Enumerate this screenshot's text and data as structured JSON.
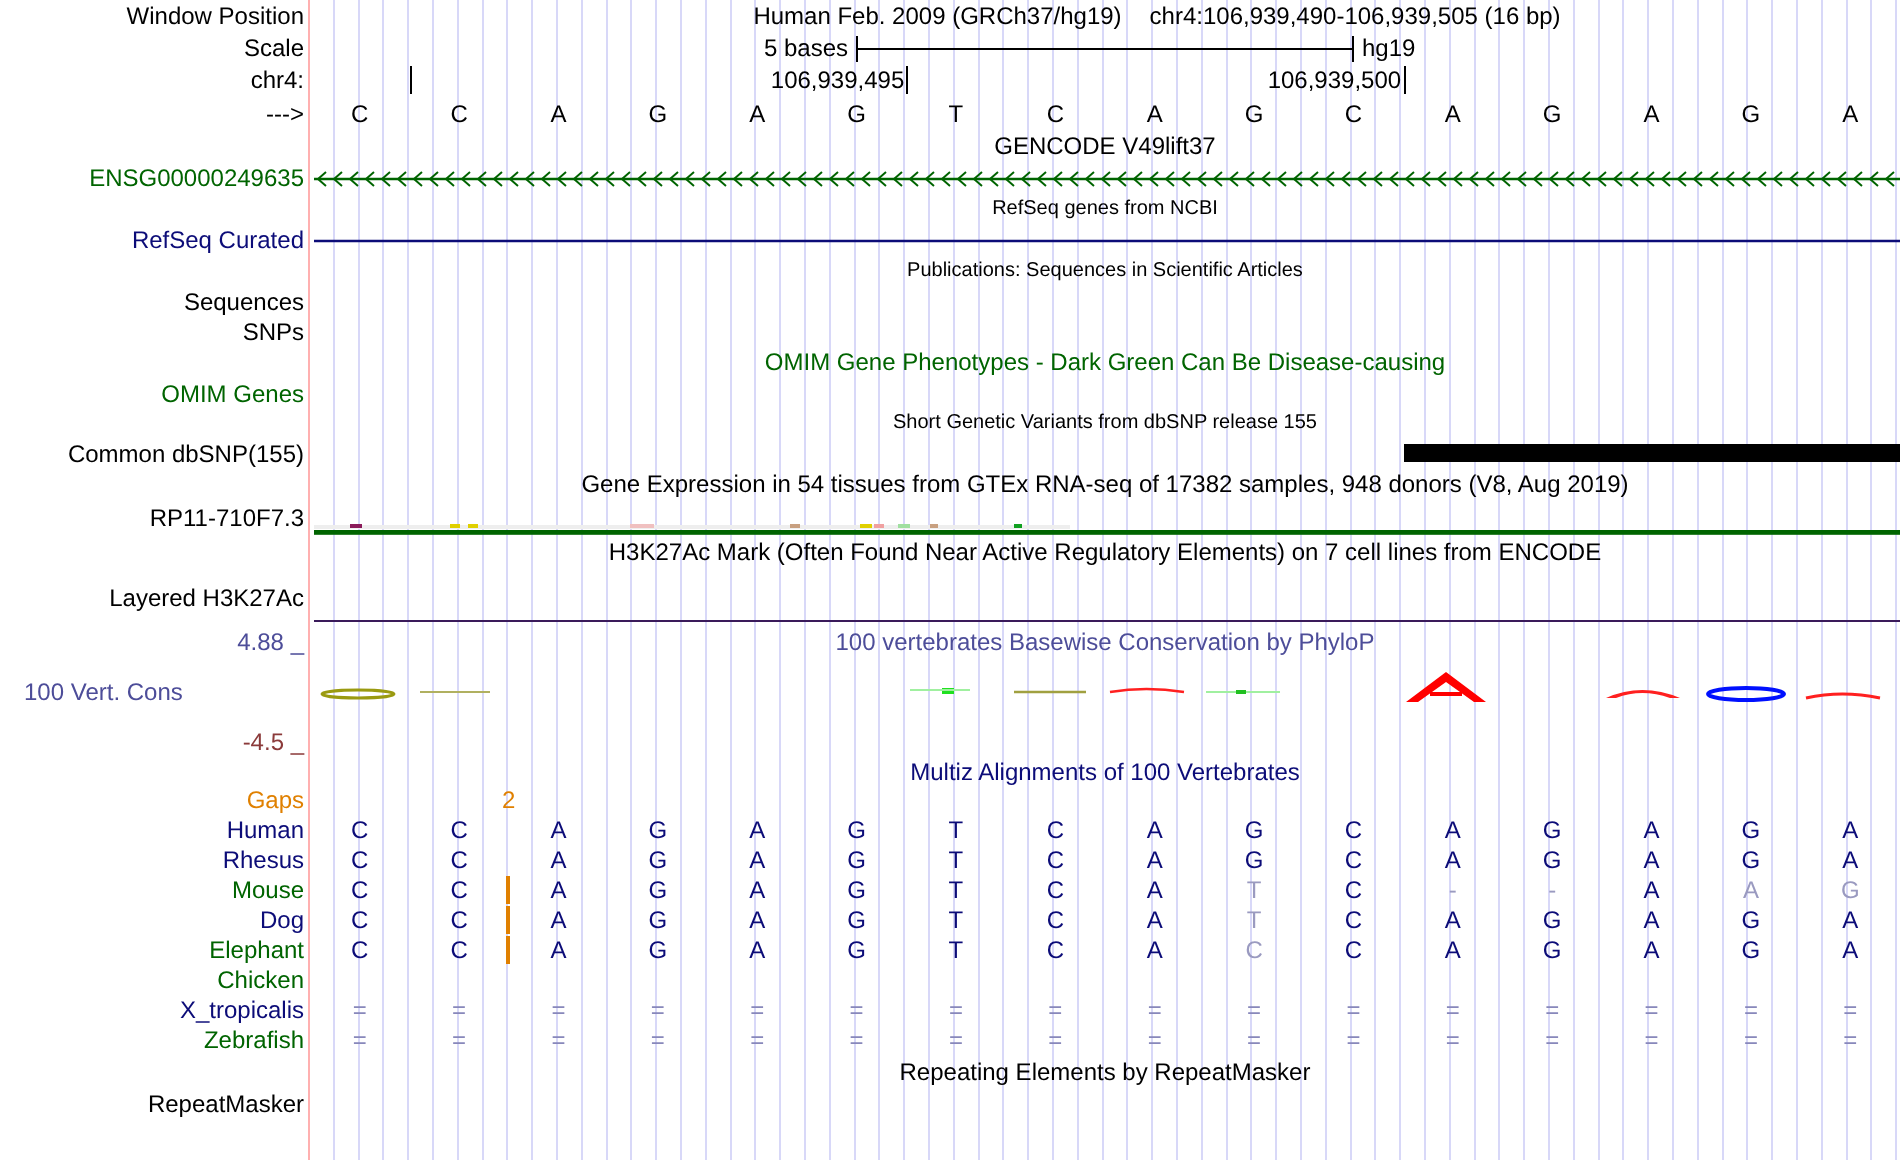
{
  "header": {
    "label": "Window Position",
    "assembly": "Human Feb. 2009 (GRCh37/hg19)",
    "position": "chr4:106,939,490-106,939,505 (16 bp)"
  },
  "scale": {
    "label": "Scale",
    "span": "5 bases",
    "database": "hg19"
  },
  "ruler": {
    "label": "chr4:",
    "ticks": [
      "106,939,495",
      "106,939,500"
    ]
  },
  "sequence": {
    "label": "--->",
    "bases": [
      "C",
      "C",
      "A",
      "G",
      "A",
      "G",
      "T",
      "C",
      "A",
      "G",
      "C",
      "A",
      "G",
      "A",
      "G",
      "A"
    ]
  },
  "tracks": [
    {
      "kind": "title",
      "text": "GENCODE V49lift37",
      "color": "#000000"
    },
    {
      "kind": "gene",
      "label": "ENSG00000249635",
      "color": "#006400",
      "arrows": true
    },
    {
      "kind": "caption",
      "text": "RefSeq genes from NCBI",
      "color": "#000000"
    },
    {
      "kind": "gene",
      "label": "RefSeq Curated",
      "color": "#0c0c78",
      "arrows": false
    },
    {
      "kind": "caption",
      "text": "Publications: Sequences in Scientific Articles",
      "color": "#000000"
    },
    {
      "kind": "label",
      "label": "Sequences",
      "color": "#000000"
    },
    {
      "kind": "label",
      "label": "SNPs",
      "color": "#000000"
    },
    {
      "kind": "title",
      "text": "OMIM Gene Phenotypes - Dark Green Can Be Disease-causing",
      "color": "#006400"
    },
    {
      "kind": "label",
      "label": "OMIM Genes",
      "color": "#006400"
    },
    {
      "kind": "caption",
      "text": "Short Genetic Variants from dbSNP release 155",
      "color": "#000000"
    },
    {
      "kind": "bar",
      "label": "Common dbSNP(155)",
      "color": "#000000",
      "covered": [
        false,
        false,
        false,
        false,
        false,
        false,
        false,
        false,
        false,
        false,
        false,
        true,
        true,
        true,
        true,
        true
      ]
    },
    {
      "kind": "title",
      "text": "Gene Expression in 54 tissues from GTEx RNA-seq of 17382 samples, 948 donors (V8, Aug 2019)",
      "color": "#000000"
    },
    {
      "kind": "expression",
      "label": "RP11-710F7.3",
      "color": "#000000"
    },
    {
      "kind": "title",
      "text": "H3K27Ac Mark (Often Found Near Active Regulatory Elements) on 7 cell lines from ENCODE",
      "color": "#000000"
    },
    {
      "kind": "signal",
      "label": "Layered H3K27Ac",
      "color": "#000000"
    }
  ],
  "conservation": {
    "top": "4.88 _",
    "label": "100 Vert. Cons",
    "bottom": "-4.5 _",
    "title": "100 vertebrates Basewise Conservation by PhyloP"
  },
  "multiz": {
    "title": "Multiz Alignments of 100 Vertebrates",
    "gaps_label": "Gaps",
    "gap_count": "2",
    "species": [
      {
        "name": "Human",
        "color": "#0c0c78",
        "kind": "bases",
        "insertion": false,
        "bases": [
          "C",
          "C",
          "A",
          "G",
          "A",
          "G",
          "T",
          "C",
          "A",
          "G",
          "C",
          "A",
          "G",
          "A",
          "G",
          "A"
        ],
        "dim": [
          false,
          false,
          false,
          false,
          false,
          false,
          false,
          false,
          false,
          false,
          false,
          false,
          false,
          false,
          false,
          false
        ]
      },
      {
        "name": "Rhesus",
        "color": "#0c0c78",
        "kind": "bases",
        "insertion": false,
        "bases": [
          "C",
          "C",
          "A",
          "G",
          "A",
          "G",
          "T",
          "C",
          "A",
          "G",
          "C",
          "A",
          "G",
          "A",
          "G",
          "A"
        ],
        "dim": [
          false,
          false,
          false,
          false,
          false,
          false,
          false,
          false,
          false,
          false,
          false,
          false,
          false,
          false,
          false,
          false
        ]
      },
      {
        "name": "Mouse",
        "color": "#006400",
        "kind": "bases",
        "insertion": true,
        "bases": [
          "C",
          "C",
          "A",
          "G",
          "A",
          "G",
          "T",
          "C",
          "A",
          "T",
          "C",
          "-",
          "-",
          "A",
          "A",
          "G"
        ],
        "dim": [
          false,
          false,
          false,
          false,
          false,
          false,
          false,
          false,
          false,
          true,
          false,
          true,
          true,
          false,
          true,
          true
        ]
      },
      {
        "name": "Dog",
        "color": "#0c0c78",
        "kind": "bases",
        "insertion": true,
        "bases": [
          "C",
          "C",
          "A",
          "G",
          "A",
          "G",
          "T",
          "C",
          "A",
          "T",
          "C",
          "A",
          "G",
          "A",
          "G",
          "A"
        ],
        "dim": [
          false,
          false,
          false,
          false,
          false,
          false,
          false,
          false,
          false,
          true,
          false,
          false,
          false,
          false,
          false,
          false
        ]
      },
      {
        "name": "Elephant",
        "color": "#006400",
        "kind": "bases",
        "insertion": true,
        "bases": [
          "C",
          "C",
          "A",
          "G",
          "A",
          "G",
          "T",
          "C",
          "A",
          "C",
          "C",
          "A",
          "G",
          "A",
          "G",
          "A"
        ],
        "dim": [
          false,
          false,
          false,
          false,
          false,
          false,
          false,
          false,
          false,
          true,
          false,
          false,
          false,
          false,
          false,
          false
        ]
      },
      {
        "name": "Chicken",
        "color": "#006400",
        "kind": "none",
        "insertion": false
      },
      {
        "name": "X_tropicalis",
        "color": "#0c0c78",
        "kind": "continuation",
        "insertion": false,
        "bases": [
          "=",
          "=",
          "=",
          "=",
          "=",
          "=",
          "=",
          "=",
          "=",
          "=",
          "=",
          "=",
          "=",
          "=",
          "=",
          "="
        ]
      },
      {
        "name": "Zebrafish",
        "color": "#006400",
        "kind": "continuation",
        "insertion": false,
        "bases": [
          "=",
          "=",
          "=",
          "=",
          "=",
          "=",
          "=",
          "=",
          "=",
          "=",
          "=",
          "=",
          "=",
          "=",
          "=",
          "="
        ]
      }
    ]
  },
  "repeats": {
    "title": "Repeating Elements by RepeatMasker",
    "label": "RepeatMasker"
  }
}
